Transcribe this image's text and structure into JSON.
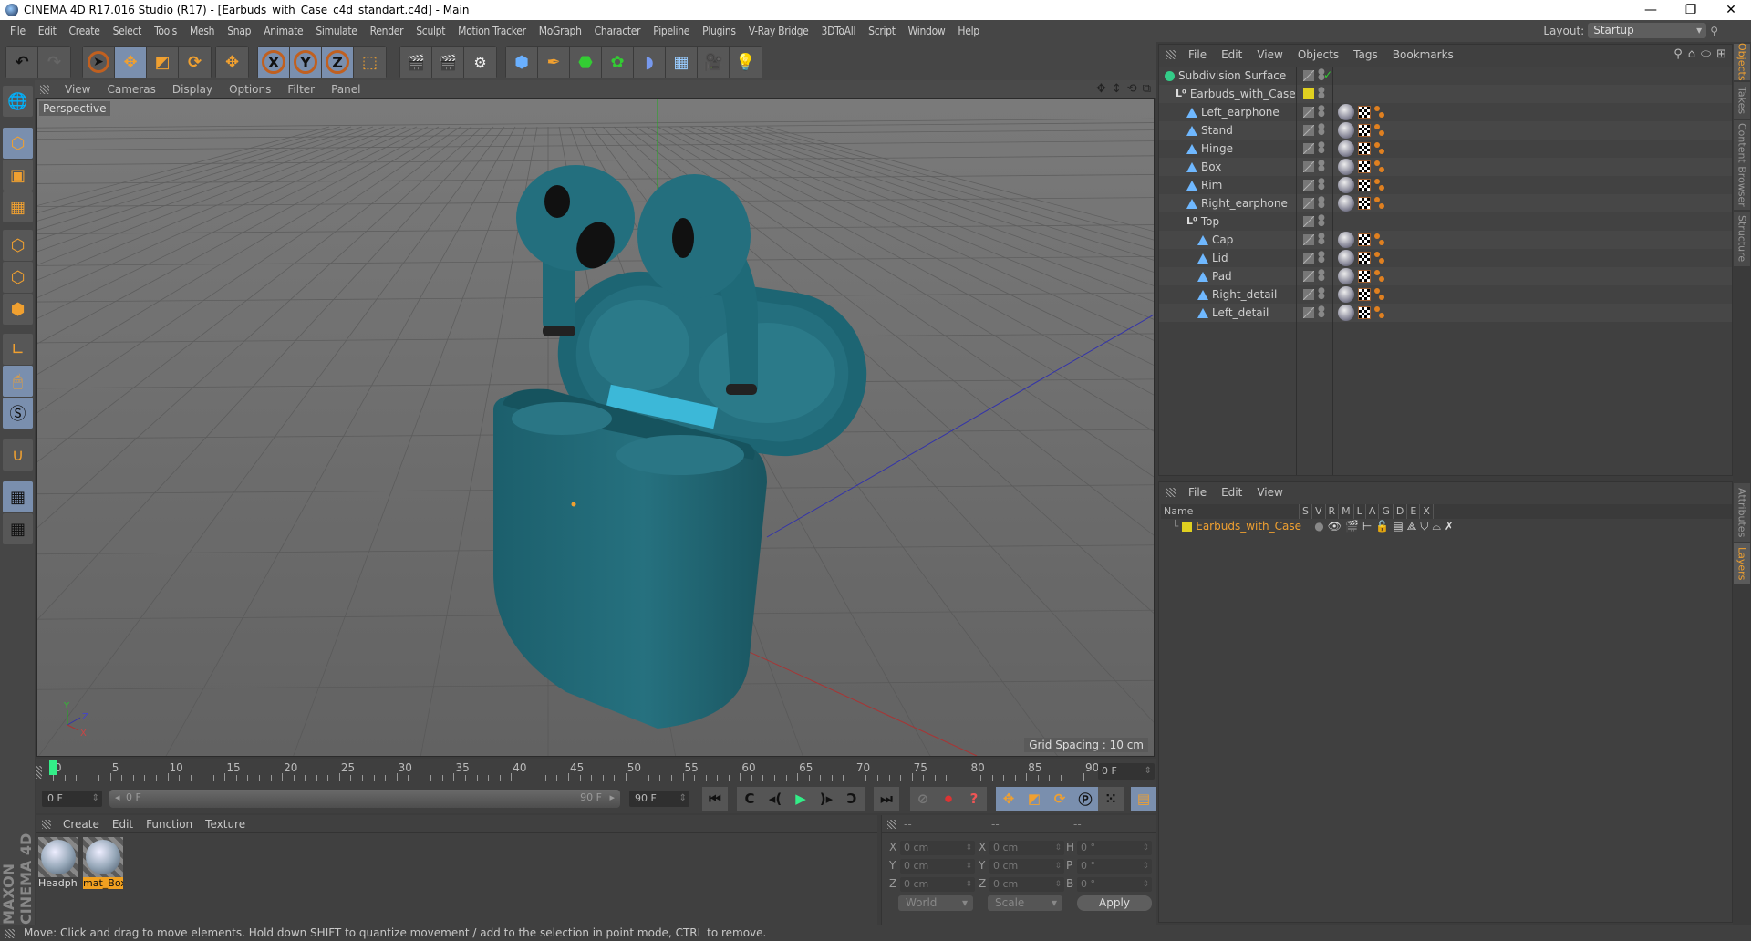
{
  "window": {
    "title": "CINEMA 4D R17.016 Studio (R17) - [Earbuds_with_Case_c4d_standart.c4d] - Main",
    "controls": [
      "minimize",
      "maximize",
      "close"
    ]
  },
  "menubar": {
    "items": [
      "File",
      "Edit",
      "Create",
      "Select",
      "Tools",
      "Mesh",
      "Snap",
      "Animate",
      "Simulate",
      "Render",
      "Sculpt",
      "Motion Tracker",
      "MoGraph",
      "Character",
      "Pipeline",
      "Plugins",
      "V-Ray Bridge",
      "3DToAll",
      "Script",
      "Window",
      "Help"
    ],
    "layout_label": "Layout:",
    "layout_value": "Startup"
  },
  "toolbar": {
    "groups": [
      {
        "name": "history",
        "tools": [
          "undo-icon",
          "redo-icon"
        ]
      },
      {
        "name": "transform",
        "tools": [
          "select-live-icon",
          "move-icon",
          "scale-icon",
          "rotate-icon"
        ]
      },
      {
        "name": "last",
        "tools": [
          "last-tool-icon"
        ]
      },
      {
        "name": "axis",
        "tools": [
          "x-axis-icon",
          "y-axis-icon",
          "z-axis-icon",
          "coordinate-system-icon"
        ]
      },
      {
        "name": "render",
        "tools": [
          "render-view-icon",
          "render-picture-viewer-icon",
          "edit-render-settings-icon"
        ]
      },
      {
        "name": "create",
        "tools": [
          "cube-icon",
          "pen-icon",
          "subdivision-icon",
          "array-icon",
          "deformer-icon",
          "floor-icon",
          "camera-icon",
          "light-icon"
        ]
      }
    ],
    "axis_labels": [
      "X",
      "Y",
      "Z"
    ]
  },
  "left_tools": [
    "make-editable-icon",
    "model-mode-icon",
    "texture-mode-icon",
    "workplane-icon",
    "points-mode-icon",
    "edges-mode-icon",
    "polygons-mode-icon",
    "axis-mode-icon",
    "tweak-mode-icon",
    "solo-icon",
    "snap-icon",
    "lock-workplane-icon",
    "planar-workplane-icon"
  ],
  "viewport": {
    "menu": [
      "View",
      "Cameras",
      "Display",
      "Options",
      "Filter",
      "Panel"
    ],
    "camera_label": "Perspective",
    "grid_spacing": "Grid Spacing : 10 cm",
    "axis_labels": [
      "Y",
      "Z",
      "X"
    ],
    "model_color": "#1f6a78",
    "hinge_color": "#3cb8d8"
  },
  "timeline": {
    "labels": [
      "0",
      "5",
      "10",
      "15",
      "20",
      "25",
      "30",
      "35",
      "40",
      "45",
      "50",
      "55",
      "60",
      "65",
      "70",
      "75",
      "80",
      "85",
      "90"
    ],
    "current_frame": "0 F",
    "start_field": "0 F",
    "range_start": "0 F",
    "range_end": "90 F",
    "end_field": "90 F"
  },
  "transport": {
    "buttons": [
      "go-to-start-icon",
      "prev-key-icon",
      "prev-frame-icon",
      "play-icon",
      "next-frame-icon",
      "next-key-icon",
      "go-to-end-icon"
    ],
    "record": [
      "motion-record-icon",
      "autokey-icon",
      "keyframe-selection-icon"
    ],
    "key_tracks": [
      "position-key-icon",
      "scale-key-icon",
      "rotation-key-icon",
      "param-key-icon",
      "point-level-icon"
    ],
    "timeline_button": "timeline-icon"
  },
  "material_manager": {
    "menu": [
      "Create",
      "Edit",
      "Function",
      "Texture"
    ],
    "materials": [
      {
        "name": "Headph",
        "selected": false
      },
      {
        "name": "mat_Box",
        "selected": true
      }
    ],
    "brand": "MAXON CINEMA 4D"
  },
  "coordinates": {
    "headers": [
      "--",
      "--",
      "--"
    ],
    "rows": [
      {
        "a": "X",
        "pos": "0 cm",
        "b": "X",
        "size": "0 cm",
        "c": "H",
        "rot": "0 °"
      },
      {
        "a": "Y",
        "pos": "0 cm",
        "b": "Y",
        "size": "0 cm",
        "c": "P",
        "rot": "0 °"
      },
      {
        "a": "Z",
        "pos": "0 cm",
        "b": "Z",
        "size": "0 cm",
        "c": "B",
        "rot": "0 °"
      }
    ],
    "mode": "World",
    "scale": "Scale",
    "apply": "Apply"
  },
  "status_bar": "Move: Click and drag to move elements. Hold down SHIFT to quantize movement / add to the selection in point mode, CTRL to remove.",
  "object_manager": {
    "menu": [
      "File",
      "Edit",
      "View",
      "Objects",
      "Tags",
      "Bookmarks"
    ],
    "objects": [
      {
        "name": "Subdivision Surface",
        "type": "subdivision",
        "depth": 0,
        "tags": false,
        "check": true
      },
      {
        "name": "Earbuds_with_Case",
        "type": "null",
        "depth": 1,
        "tags": false,
        "layer": true
      },
      {
        "name": "Left_earphone",
        "type": "poly",
        "depth": 2,
        "tags": true
      },
      {
        "name": "Stand",
        "type": "poly",
        "depth": 2,
        "tags": true
      },
      {
        "name": "Hinge",
        "type": "poly",
        "depth": 2,
        "tags": true
      },
      {
        "name": "Box",
        "type": "poly",
        "depth": 2,
        "tags": true
      },
      {
        "name": "Rim",
        "type": "poly",
        "depth": 2,
        "tags": true
      },
      {
        "name": "Right_earphone",
        "type": "poly",
        "depth": 2,
        "tags": true
      },
      {
        "name": "Top",
        "type": "null",
        "depth": 2,
        "tags": false
      },
      {
        "name": "Cap",
        "type": "poly",
        "depth": 3,
        "tags": true
      },
      {
        "name": "Lid",
        "type": "poly",
        "depth": 3,
        "tags": true
      },
      {
        "name": "Pad",
        "type": "poly",
        "depth": 3,
        "tags": true
      },
      {
        "name": "Right_detail",
        "type": "poly",
        "depth": 3,
        "tags": true
      },
      {
        "name": "Left_detail",
        "type": "poly",
        "depth": 3,
        "tags": true
      }
    ]
  },
  "layer_manager": {
    "menu": [
      "File",
      "Edit",
      "View"
    ],
    "columns": [
      "Name",
      "S",
      "V",
      "R",
      "M",
      "L",
      "A",
      "G",
      "D",
      "E",
      "X"
    ],
    "layers": [
      {
        "name": "Earbuds_with_Case",
        "color": "#e0d020"
      }
    ]
  },
  "side_tabs": {
    "top": [
      {
        "label": "Objects",
        "active": true
      },
      {
        "label": "Takes",
        "active": false
      },
      {
        "label": "Content Browser",
        "active": false
      },
      {
        "label": "Structure",
        "active": false
      }
    ],
    "bottom": [
      {
        "label": "Attributes",
        "active": false
      },
      {
        "label": "Layers",
        "active": true
      }
    ]
  },
  "colors": {
    "accent": "#f0a030",
    "selected_button": "#7a8fae",
    "layer_yellow": "#e0d020"
  }
}
